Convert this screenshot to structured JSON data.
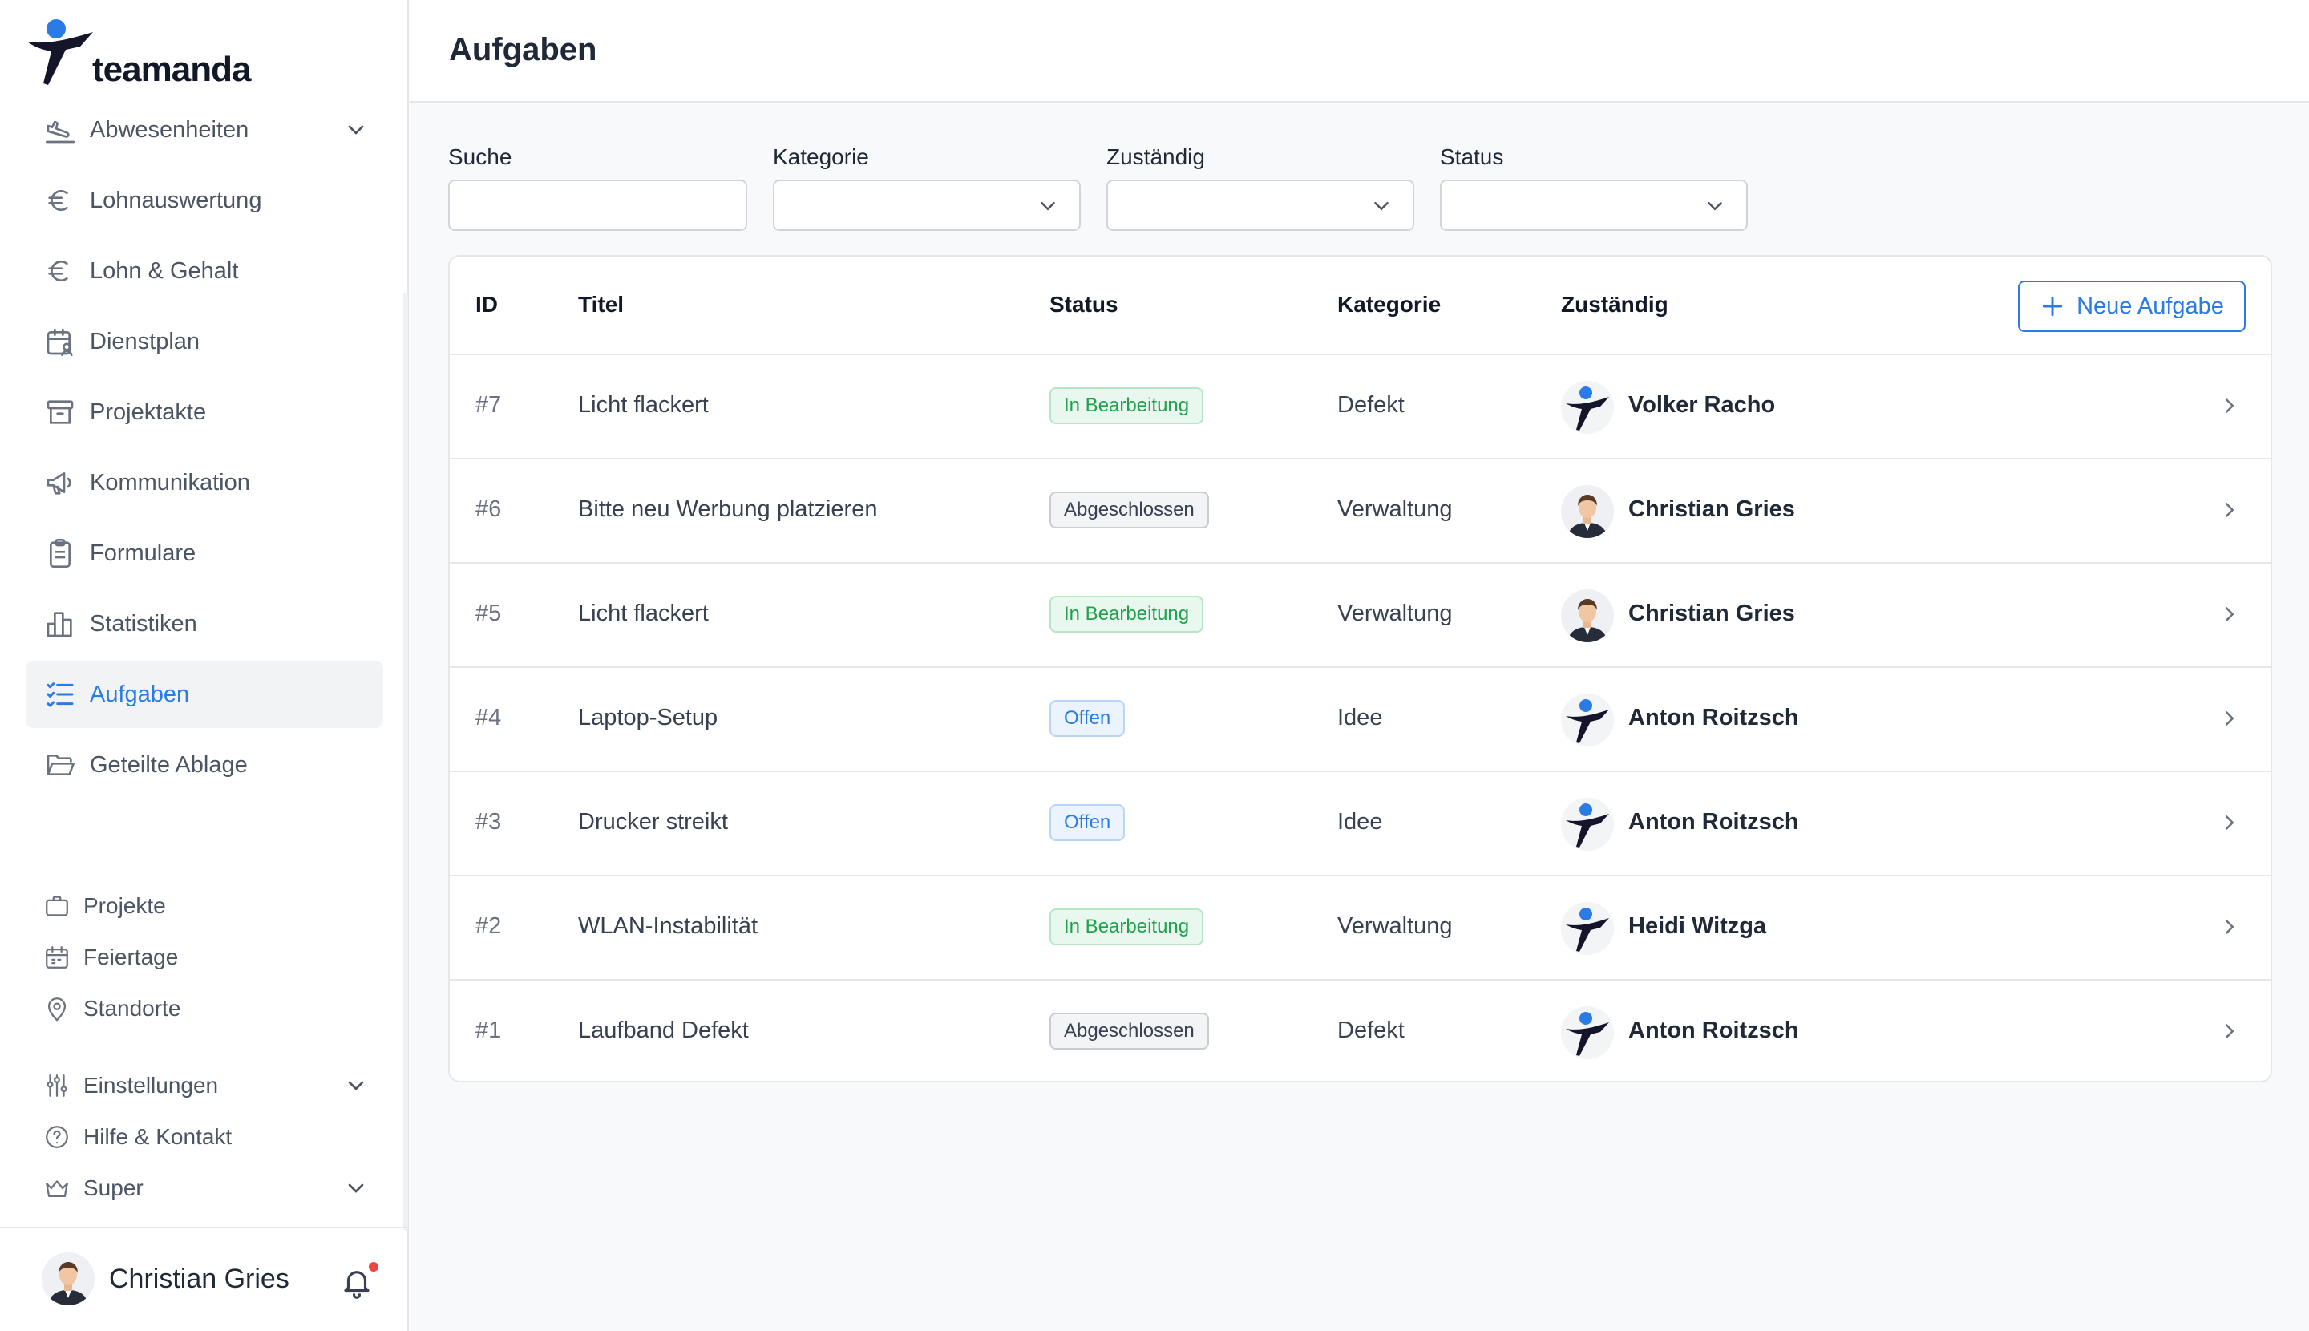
{
  "brand": {
    "name": "teamanda",
    "accent": "#2b7be6"
  },
  "sidebar": {
    "items": [
      {
        "label": "Abwesenheiten",
        "icon": "plane-landing-icon",
        "expandable": true
      },
      {
        "label": "Lohnauswertung",
        "icon": "euro-icon"
      },
      {
        "label": "Lohn & Gehalt",
        "icon": "euro-icon"
      },
      {
        "label": "Dienstplan",
        "icon": "calendar-user-icon"
      },
      {
        "label": "Projektakte",
        "icon": "archive-icon"
      },
      {
        "label": "Kommunikation",
        "icon": "megaphone-icon"
      },
      {
        "label": "Formulare",
        "icon": "clipboard-icon"
      },
      {
        "label": "Statistiken",
        "icon": "bar-chart-icon"
      },
      {
        "label": "Aufgaben",
        "icon": "task-list-icon",
        "active": true
      },
      {
        "label": "Geteilte Ablage",
        "icon": "folder-open-icon"
      }
    ],
    "secondary": [
      {
        "label": "Projekte",
        "icon": "briefcase-icon"
      },
      {
        "label": "Feiertage",
        "icon": "calendar-icon"
      },
      {
        "label": "Standorte",
        "icon": "map-pin-icon"
      },
      {
        "label": "Einstellungen",
        "icon": "sliders-icon",
        "expandable": true
      },
      {
        "label": "Hilfe & Kontakt",
        "icon": "help-circle-icon"
      },
      {
        "label": "Super",
        "icon": "crown-icon",
        "expandable": true
      }
    ],
    "user": {
      "name": "Christian Gries",
      "has_notification": true
    }
  },
  "header": {
    "title": "Aufgaben"
  },
  "filters": {
    "search_label": "Suche",
    "category_label": "Kategorie",
    "assignee_label": "Zuständig",
    "status_label": "Status"
  },
  "table": {
    "columns": {
      "id": "ID",
      "title": "Titel",
      "status": "Status",
      "category": "Kategorie",
      "assignee": "Zuständig"
    },
    "new_button": "Neue Aufgabe",
    "rows": [
      {
        "id": "#7",
        "title": "Licht flackert",
        "status": "In Bearbeitung",
        "status_tone": "green",
        "category": "Defekt",
        "assignee": "Volker Racho",
        "avatar": "logo"
      },
      {
        "id": "#6",
        "title": "Bitte neu Werbung platzieren",
        "status": "Abgeschlossen",
        "status_tone": "gray",
        "category": "Verwaltung",
        "assignee": "Christian Gries",
        "avatar": "person"
      },
      {
        "id": "#5",
        "title": "Licht flackert",
        "status": "In Bearbeitung",
        "status_tone": "green",
        "category": "Verwaltung",
        "assignee": "Christian Gries",
        "avatar": "person"
      },
      {
        "id": "#4",
        "title": "Laptop-Setup",
        "status": "Offen",
        "status_tone": "blue",
        "category": "Idee",
        "assignee": "Anton Roitzsch",
        "avatar": "logo"
      },
      {
        "id": "#3",
        "title": "Drucker streikt",
        "status": "Offen",
        "status_tone": "blue",
        "category": "Idee",
        "assignee": "Anton Roitzsch",
        "avatar": "logo"
      },
      {
        "id": "#2",
        "title": "WLAN-Instabilität",
        "status": "In Bearbeitung",
        "status_tone": "green",
        "category": "Verwaltung",
        "assignee": "Heidi Witzga",
        "avatar": "logo"
      },
      {
        "id": "#1",
        "title": "Laufband Defekt",
        "status": "Abgeschlossen",
        "status_tone": "gray",
        "category": "Defekt",
        "assignee": "Anton Roitzsch",
        "avatar": "logo"
      }
    ]
  }
}
